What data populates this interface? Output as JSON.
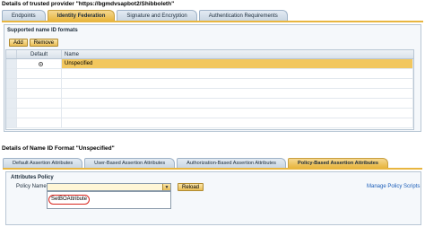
{
  "provider": {
    "title": "Details of trusted provider \"https://bgmdvsapbot2/Shibboleth\"",
    "tabs": [
      {
        "label": "Endpoints",
        "active": false
      },
      {
        "label": "Identity Federation",
        "active": true
      },
      {
        "label": "Signature and Encryption",
        "active": false
      },
      {
        "label": "Authentication Requirements",
        "active": false
      }
    ]
  },
  "name_id_formats": {
    "heading": "Supported name ID formats",
    "add_label": "Add",
    "remove_label": "Remove",
    "columns": [
      "Default",
      "Name"
    ],
    "rows": [
      {
        "default": true,
        "name": "Unspecified"
      }
    ]
  },
  "details": {
    "title": "Details of Name ID Format \"Unspecified\"",
    "tabs": [
      {
        "label": "Default Assertion Attributes",
        "active": false
      },
      {
        "label": "User-Based Assertion Attributes",
        "active": false
      },
      {
        "label": "Authorization-Based Assertion Attributes",
        "active": false
      },
      {
        "label": "Policy-Based Assertion Attributes",
        "active": true
      }
    ],
    "attributes_policy": {
      "heading": "Attributes Policy",
      "policy_name_label": "Policy Name:",
      "policy_name_value": "",
      "reload_label": "Reload",
      "manage_label": "Manage Policy Scripts",
      "dropdown_options": [
        "SetBOAttribute"
      ]
    }
  },
  "colors": {
    "accent": "#e8b640",
    "link": "#1a5db8",
    "highlight_ring": "#d8261e"
  }
}
